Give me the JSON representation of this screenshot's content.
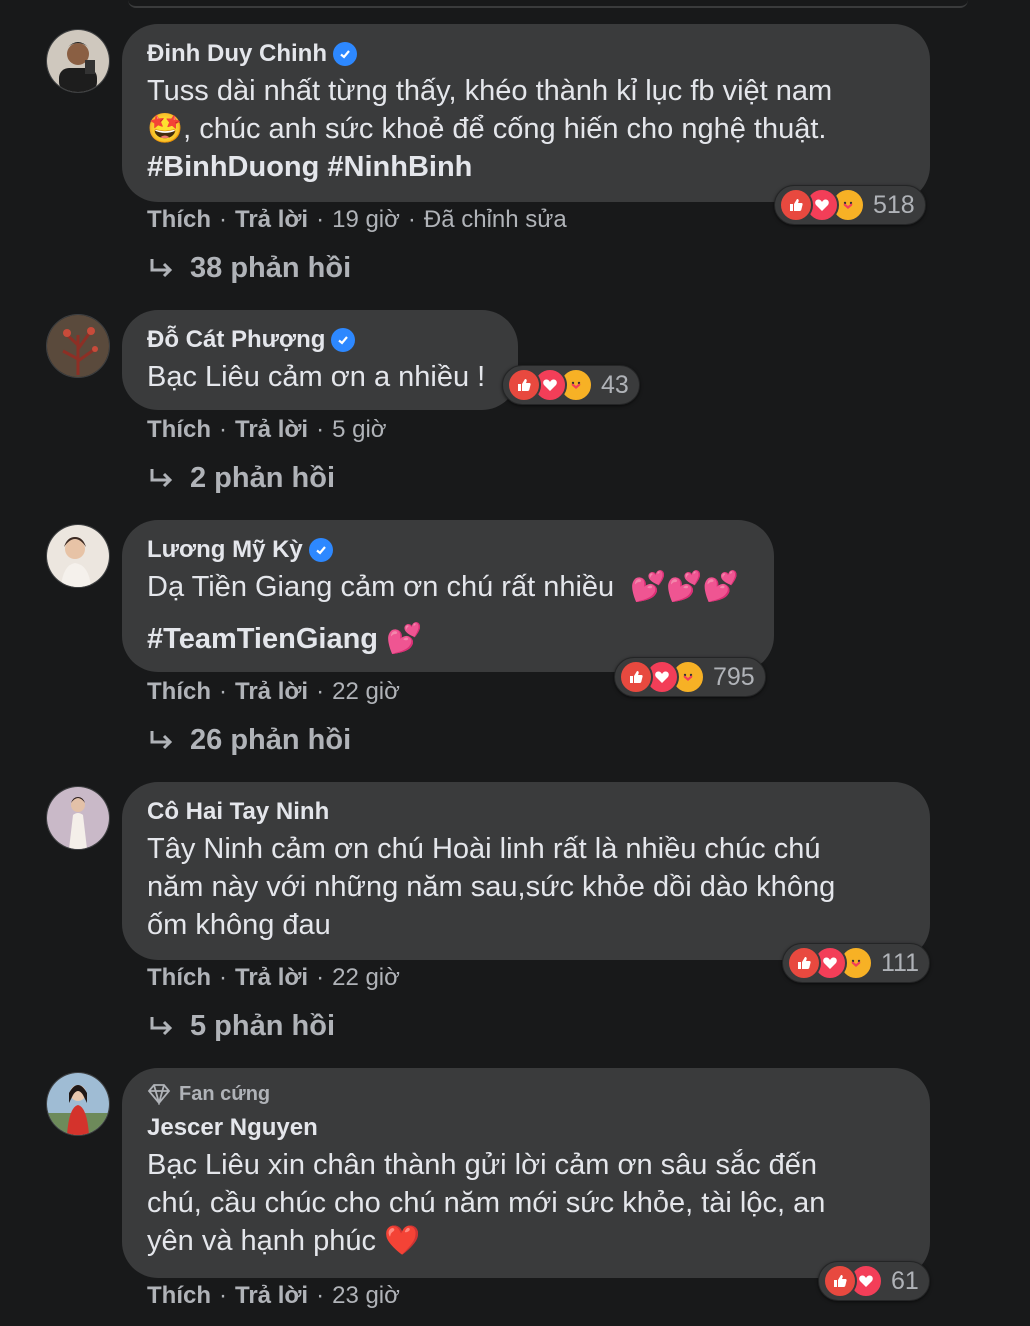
{
  "comments": [
    {
      "author": "Đinh Duy Chinh",
      "verified": true,
      "text_line1": "Tuss dài nhất từng thấy, khéo thành kỉ lục fb việt nam",
      "text_line2": ", chúc anh sức khoẻ để cống hiến cho nghệ thuật.",
      "emoji": "🤩",
      "hashtags": "#BinhDuong #NinhBinh",
      "reaction_count": "518",
      "like_label": "Thích",
      "reply_label": "Trả lời",
      "time": "19 giờ",
      "edited": "Đã chỉnh sửa",
      "replies": "38 phản hồi"
    },
    {
      "author": "Đỗ Cát Phượng",
      "verified": true,
      "text": "Bạc Liêu cảm ơn a nhiều !",
      "reaction_count": "43",
      "like_label": "Thích",
      "reply_label": "Trả lời",
      "time": "5 giờ",
      "replies": "2 phản hồi"
    },
    {
      "author": "Lương Mỹ Kỳ",
      "verified": true,
      "text": "Dạ Tiền Giang cảm ơn chú rất nhiều",
      "emoji": "💕💕💕",
      "hashtag": "#TeamTienGiang",
      "hashtag_emoji": "💕",
      "reaction_count": "795",
      "like_label": "Thích",
      "reply_label": "Trả lời",
      "time": "22 giờ",
      "replies": "26 phản hồi"
    },
    {
      "author": "Cô Hai Tay Ninh",
      "verified": false,
      "text": "Tây Ninh cảm ơn chú Hoài linh rất là nhiều chúc chú\nnăm này với những năm sau,sức khỏe dồi dào không\nốm không đau",
      "reaction_count": "111",
      "like_label": "Thích",
      "reply_label": "Trả lời",
      "time": "22 giờ",
      "replies": "5 phản hồi"
    },
    {
      "badge": "Fan cứng",
      "author": "Jescer Nguyen",
      "verified": false,
      "text": "Bạc Liêu xin chân thành gửi lời cảm ơn sâu sắc đến\nchú, cầu chúc cho chú năm mới sức khỏe, tài lộc, an\nyên và hạnh phúc",
      "emoji": "❤️",
      "reaction_count": "61",
      "like_label": "Thích",
      "reply_label": "Trả lời",
      "time": "23 giờ"
    }
  ],
  "colors": {
    "background": "#18191a",
    "bubble": "#3a3b3c",
    "text": "#e4e6eb",
    "secondary": "#b0b3b8",
    "verified": "#2d88ff",
    "like": "#e8493f",
    "love": "#f33e58",
    "care": "#f7b125"
  }
}
